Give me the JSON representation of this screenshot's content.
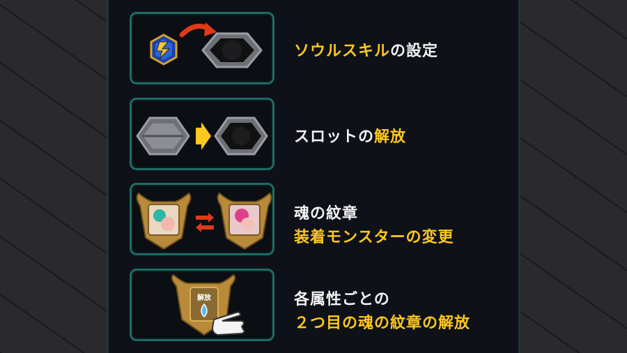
{
  "rows": [
    {
      "label_main": "ソウルスキル",
      "label_suffix": "の設定"
    },
    {
      "label_prefix": "スロットの",
      "label_main": "解放"
    },
    {
      "line1": "魂の紋章",
      "line2": "装着モンスターの変更"
    },
    {
      "line1": "各属性ごとの",
      "line2": "２つ目の魂の紋章の解放",
      "badge": "解放"
    }
  ],
  "colors": {
    "accent": "#ffc81e",
    "text": "#f2f2f2",
    "frame": "#1f6b64",
    "arrow_red": "#e03a1a"
  }
}
